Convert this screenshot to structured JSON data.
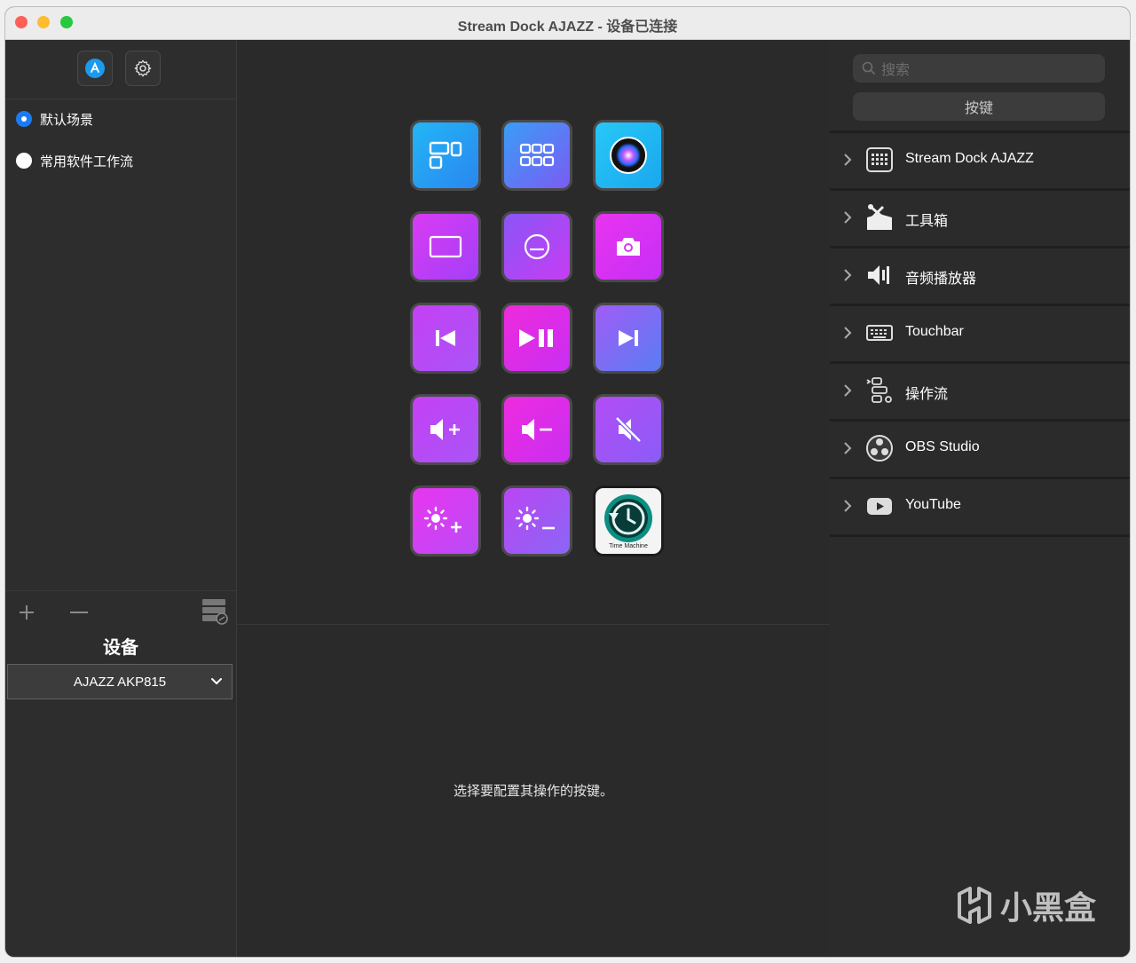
{
  "window": {
    "title": "Stream Dock AJAZZ - 设备已连接"
  },
  "sidebar": {
    "scenes": [
      {
        "label": "默认场景",
        "selected": true
      },
      {
        "label": "常用软件工作流",
        "selected": false
      }
    ],
    "device_title": "设备",
    "device_select": "AJAZZ AKP815"
  },
  "center": {
    "keys": [
      {
        "icon": "window-layout-icon",
        "colors": [
          "#23b6f5",
          "#2a86f0"
        ]
      },
      {
        "icon": "grid-apps-icon",
        "colors": [
          "#3a9df6",
          "#7a5cf4"
        ]
      },
      {
        "icon": "siri-icon",
        "colors": [
          "#28c8f6",
          "#1aa7ef"
        ]
      },
      {
        "icon": "rectangle-icon",
        "colors": [
          "#d93cf3",
          "#a43ef8"
        ]
      },
      {
        "icon": "circle-minus-icon",
        "colors": [
          "#8a55f6",
          "#c63df4"
        ]
      },
      {
        "icon": "camera-icon",
        "colors": [
          "#e934f0",
          "#c62ff6"
        ]
      },
      {
        "icon": "previous-track-icon",
        "colors": [
          "#c640f5",
          "#a855f7"
        ]
      },
      {
        "icon": "play-pause-icon",
        "colors": [
          "#ee2bdc",
          "#c92ef2"
        ]
      },
      {
        "icon": "next-track-icon",
        "colors": [
          "#a05cf6",
          "#5a7df4"
        ]
      },
      {
        "icon": "volume-up-icon",
        "colors": [
          "#c640f5",
          "#a855f7"
        ]
      },
      {
        "icon": "volume-down-icon",
        "colors": [
          "#ef2be0",
          "#c82ef0"
        ]
      },
      {
        "icon": "mute-icon",
        "colors": [
          "#b34df6",
          "#8a5cf6"
        ]
      },
      {
        "icon": "brightness-up-icon",
        "colors": [
          "#e935f0",
          "#b84cf6"
        ]
      },
      {
        "icon": "brightness-down-icon",
        "colors": [
          "#bb46f4",
          "#8a66f5"
        ]
      },
      {
        "icon": "time-machine-icon",
        "colors": [
          "#1f1f1f",
          "#1f1f1f"
        ],
        "caption": "Time Machine"
      }
    ],
    "hint": "选择要配置其操作的按键。"
  },
  "right": {
    "search_placeholder": "搜索",
    "segment_label": "按键",
    "categories": [
      {
        "label": "Stream Dock AJAZZ",
        "icon": "device-keypad-icon"
      },
      {
        "label": "工具箱",
        "icon": "toolbox-icon"
      },
      {
        "label": "音频播放器",
        "icon": "audio-player-icon"
      },
      {
        "label": "Touchbar",
        "icon": "keyboard-icon"
      },
      {
        "label": "操作流",
        "icon": "workflow-icon"
      },
      {
        "label": "OBS Studio",
        "icon": "obs-icon"
      },
      {
        "label": "YouTube",
        "icon": "youtube-icon"
      }
    ]
  },
  "watermark": "小黑盒"
}
